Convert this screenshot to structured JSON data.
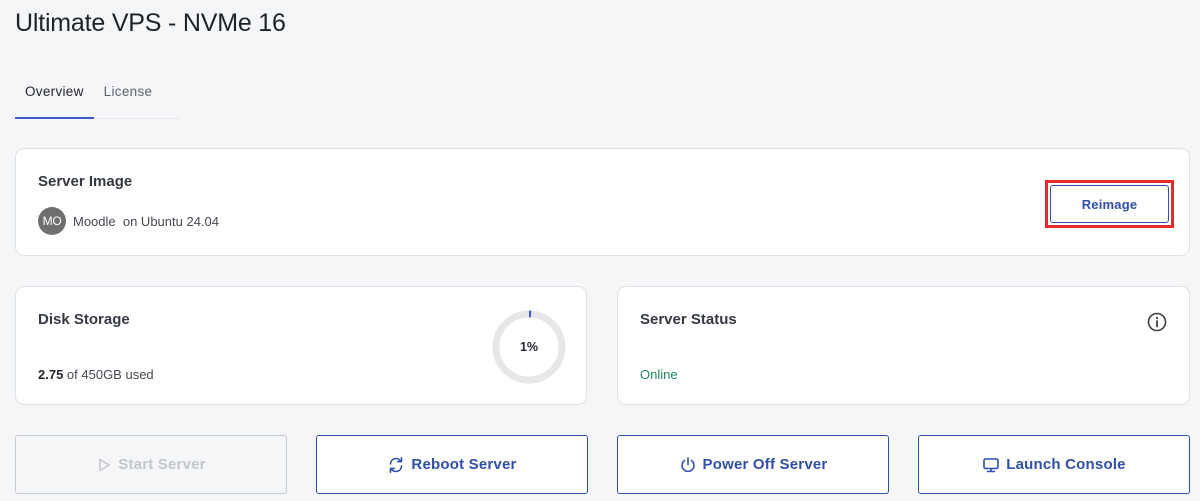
{
  "page": {
    "title": "Ultimate VPS - NVMe 16"
  },
  "tabs": [
    {
      "label": "Overview",
      "active": true
    },
    {
      "label": "License",
      "active": false
    }
  ],
  "server_image": {
    "title": "Server Image",
    "avatar_initials": "MO",
    "image_text": "Moodle  on Ubuntu 24.04",
    "reimage_label": "Reimage"
  },
  "disk_storage": {
    "title": "Disk Storage",
    "used_amount": "2.75",
    "used_suffix": " of 450GB used",
    "usage_percent_label": "1%",
    "usage_fraction": 0.01
  },
  "server_status": {
    "title": "Server Status",
    "status": "Online",
    "info_icon": "info-circle-icon"
  },
  "actions": {
    "start_label": "Start Server",
    "start_icon": "play-icon",
    "start_disabled": true,
    "reboot_label": "Reboot Server",
    "reboot_icon": "refresh-icon",
    "power_off_label": "Power Off Server",
    "power_off_icon": "power-icon",
    "console_label": "Launch Console",
    "console_icon": "monitor-icon"
  },
  "colors": {
    "accent": "#2f4fa8",
    "tab_underline": "#3a5bc7",
    "status_online": "#1f8a5b",
    "highlight_box": "#e32b2b",
    "disabled": "#c3c6cb"
  }
}
